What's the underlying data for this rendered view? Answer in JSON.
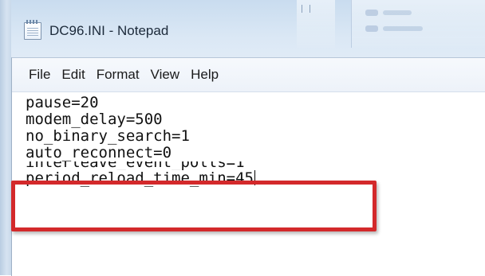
{
  "window": {
    "title": "DC96.INI - Notepad",
    "icon": "notepad-icon"
  },
  "menubar": {
    "items": [
      "File",
      "Edit",
      "Format",
      "View",
      "Help"
    ]
  },
  "editor": {
    "lines": [
      "pause=20",
      "modem_delay=500",
      "no_binary_search=1",
      "auto_reconnect=0",
      "interleave_event_polls=1",
      "period_reload_time_min=45"
    ]
  },
  "annotation": {
    "highlight_color": "#d3292b"
  }
}
